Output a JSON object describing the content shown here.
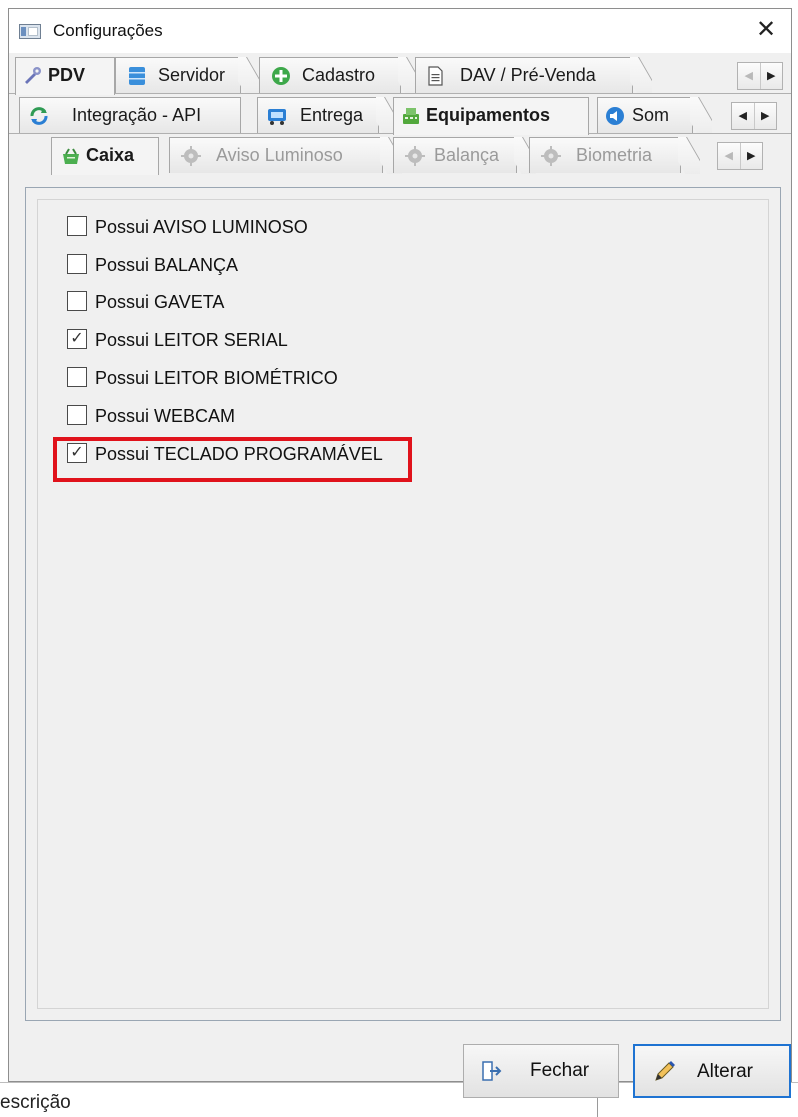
{
  "window": {
    "title": "Configurações",
    "close_glyph": "✕"
  },
  "background": {
    "partial_text": "escrição"
  },
  "tabs_row1": [
    {
      "label": "PDV",
      "icon": "wrench-icon",
      "active": true
    },
    {
      "label": "Servidor",
      "icon": "database-icon",
      "active": false
    },
    {
      "label": "Cadastro",
      "icon": "plus-circle-icon",
      "active": false
    },
    {
      "label": "DAV / Pré-Venda",
      "icon": "document-icon",
      "active": false
    }
  ],
  "tabs_row2": [
    {
      "label": "Integração - API",
      "icon": "refresh-icon",
      "active": false
    },
    {
      "label": "Entrega",
      "icon": "delivery-icon",
      "active": false
    },
    {
      "label": "Equipamentos",
      "icon": "equipment-icon",
      "active": true
    },
    {
      "label": "Som",
      "icon": "sound-icon",
      "active": false
    }
  ],
  "tabs_row3": [
    {
      "label": "Caixa",
      "icon": "cash-register-icon",
      "active": true,
      "disabled": false
    },
    {
      "label": "Aviso Luminoso",
      "icon": "gear-icon",
      "active": false,
      "disabled": true
    },
    {
      "label": "Balança",
      "icon": "gear-icon",
      "active": false,
      "disabled": true
    },
    {
      "label": "Biometria",
      "icon": "gear-icon",
      "active": false,
      "disabled": true
    }
  ],
  "nav": {
    "left": "◀",
    "right": "▶"
  },
  "checkboxes": [
    {
      "label": "Possui AVISO LUMINOSO",
      "checked": false
    },
    {
      "label": "Possui BALANÇA",
      "checked": false
    },
    {
      "label": "Possui GAVETA",
      "checked": false
    },
    {
      "label": "Possui LEITOR SERIAL",
      "checked": true
    },
    {
      "label": "Possui LEITOR BIOMÉTRICO",
      "checked": false
    },
    {
      "label": "Possui WEBCAM",
      "checked": false
    },
    {
      "label": "Possui TECLADO PROGRAMÁVEL",
      "checked": true
    }
  ],
  "check_glyph": "✓",
  "buttons": {
    "close": {
      "label": "Fechar",
      "icon": "exit-door-icon"
    },
    "edit": {
      "label": "Alterar",
      "icon": "pencil-icon"
    }
  },
  "colors": {
    "highlight": "#e0121b",
    "default_button_border": "#1e73d2",
    "tab_border": "#a7a7a7"
  }
}
